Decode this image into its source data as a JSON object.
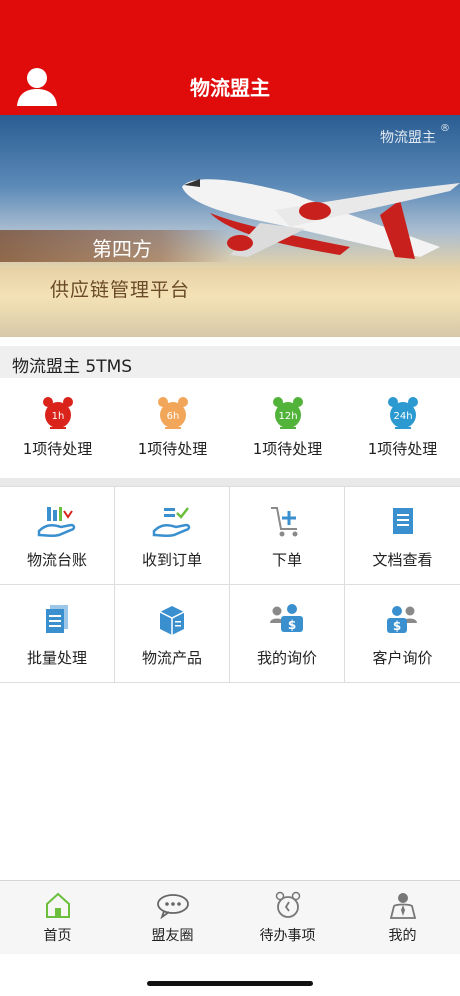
{
  "header": {
    "title": "物流盟主"
  },
  "banner": {
    "brand": "物流盟主",
    "reg": "®",
    "line1": "第四方",
    "line2": "供应链管理平台"
  },
  "section_title": "物流盟主 5TMS",
  "alarms": [
    {
      "badge": "1h",
      "color": "#d9231b",
      "label": "1项待处理",
      "icon": "alarm-clock-icon"
    },
    {
      "badge": "6h",
      "color": "#f2a65a",
      "label": "1项待处理",
      "icon": "alarm-clock-icon"
    },
    {
      "badge": "12h",
      "color": "#52b33a",
      "label": "1项待处理",
      "icon": "alarm-clock-icon"
    },
    {
      "badge": "24h",
      "color": "#2c9ad1",
      "label": "1项待处理",
      "icon": "alarm-clock-icon"
    }
  ],
  "grid": [
    {
      "label": "物流台账",
      "icon": "ledger-hand-icon"
    },
    {
      "label": "收到订单",
      "icon": "order-received-icon"
    },
    {
      "label": "下单",
      "icon": "cart-add-icon"
    },
    {
      "label": "文档查看",
      "icon": "document-icon"
    },
    {
      "label": "批量处理",
      "icon": "batch-document-icon"
    },
    {
      "label": "物流产品",
      "icon": "product-box-icon"
    },
    {
      "label": "我的询价",
      "icon": "my-inquiry-icon"
    },
    {
      "label": "客户询价",
      "icon": "customer-inquiry-icon"
    }
  ],
  "tabs": [
    {
      "label": "首页",
      "icon": "home-icon"
    },
    {
      "label": "盟友圈",
      "icon": "chat-bubble-icon"
    },
    {
      "label": "待办事项",
      "icon": "clock-icon"
    },
    {
      "label": "我的",
      "icon": "profile-icon"
    }
  ],
  "colors": {
    "header": "#e00b0b",
    "icon_blue": "#3a8fcf",
    "accent_green": "#6cbf3c"
  }
}
